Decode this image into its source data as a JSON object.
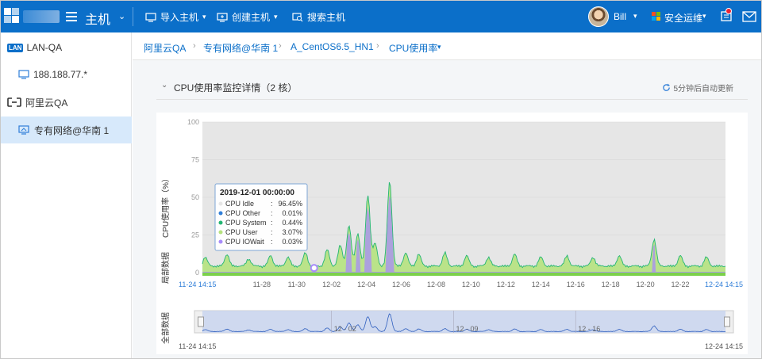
{
  "header": {
    "title": "主机",
    "nav": [
      {
        "label": "导入主机",
        "icon": "monitor-import-icon"
      },
      {
        "label": "创建主机",
        "icon": "monitor-create-icon"
      },
      {
        "label": "搜索主机",
        "icon": "monitor-search-icon"
      }
    ],
    "user": "Bill",
    "security": "安全运维",
    "brand_color": "#0b6fc9"
  },
  "sidebar": {
    "items": [
      {
        "label": "LAN-QA",
        "badge": "LAN"
      },
      {
        "label": "188.188.77.*"
      },
      {
        "label": "阿里云QA"
      },
      {
        "label": "专有网络@华南 1",
        "selected": true
      }
    ]
  },
  "breadcrumb": [
    "阿里云QA",
    "专有网络@华南 1",
    "A_CentOS6.5_HN1",
    "CPU使用率"
  ],
  "panel": {
    "title": "CPU使用率监控详情（2 核）",
    "refresh": "5分钟后自动更新"
  },
  "chart_data": {
    "type": "area",
    "ylabel": "CPU使用率（%）",
    "side_label_top": "局部数据",
    "side_label_bottom": "全部数据",
    "ylim": [
      0,
      100
    ],
    "yticks": [
      0,
      25,
      50,
      75,
      100
    ],
    "xticks": [
      "11-28",
      "11-30",
      "12-02",
      "12-04",
      "12-06",
      "12-08",
      "12-10",
      "12-12",
      "12-14",
      "12-16",
      "12-18",
      "12-20",
      "12-22"
    ],
    "range_start": "11-24 14:15",
    "range_end": "12-24 14:15",
    "navigator_ticks": [
      "12 - 02",
      "12 - 09",
      "12 - 16"
    ],
    "series": [
      {
        "name": "CPU Idle",
        "color": "#e6e6e6"
      },
      {
        "name": "CPU Other",
        "color": "#2f7ed8"
      },
      {
        "name": "CPU System",
        "color": "#22b573"
      },
      {
        "name": "CPU User",
        "color": "#b5e27e"
      },
      {
        "name": "CPU IOWait",
        "color": "#a78bfa"
      }
    ],
    "user_peaks": [
      {
        "x": "11-24 18:00",
        "y": 9
      },
      {
        "x": "11-26 00:00",
        "y": 11
      },
      {
        "x": "11-27 06:00",
        "y": 8
      },
      {
        "x": "11-28 12:00",
        "y": 10
      },
      {
        "x": "11-29 12:00",
        "y": 9
      },
      {
        "x": "11-30 12:00",
        "y": 12
      },
      {
        "x": "12-01 18:00",
        "y": 14
      },
      {
        "x": "12-02 12:00",
        "y": 17
      },
      {
        "x": "12-03 00:00",
        "y": 30
      },
      {
        "x": "12-03 12:00",
        "y": 25
      },
      {
        "x": "12-04 02:00",
        "y": 51
      },
      {
        "x": "12-04 12:00",
        "y": 18
      },
      {
        "x": "12-05 08:00",
        "y": 60
      },
      {
        "x": "12-06 06:00",
        "y": 12
      },
      {
        "x": "12-07 00:00",
        "y": 11
      },
      {
        "x": "12-08 12:00",
        "y": 12
      },
      {
        "x": "12-09 18:00",
        "y": 10
      },
      {
        "x": "12-11 00:00",
        "y": 9
      },
      {
        "x": "12-12 12:00",
        "y": 11
      },
      {
        "x": "12-14 00:00",
        "y": 9
      },
      {
        "x": "12-15 12:00",
        "y": 10
      },
      {
        "x": "12-17 00:00",
        "y": 9
      },
      {
        "x": "12-18 12:00",
        "y": 10
      },
      {
        "x": "12-20 12:00",
        "y": 21
      },
      {
        "x": "12-22 00:00",
        "y": 10
      },
      {
        "x": "12-23 12:00",
        "y": 9
      }
    ],
    "baseline": {
      "user": 3.07,
      "system": 0.44,
      "other": 0.01,
      "iowait": 0.03
    }
  },
  "tooltip": {
    "time": "2019-12-01 00:00:00",
    "rows": [
      {
        "name": "CPU Idle",
        "value": "96.45%"
      },
      {
        "name": "CPU Other",
        "value": "0.01%"
      },
      {
        "name": "CPU System",
        "value": "0.44%"
      },
      {
        "name": "CPU User",
        "value": "3.07%"
      },
      {
        "name": "CPU IOWait",
        "value": "0.03%"
      }
    ]
  }
}
